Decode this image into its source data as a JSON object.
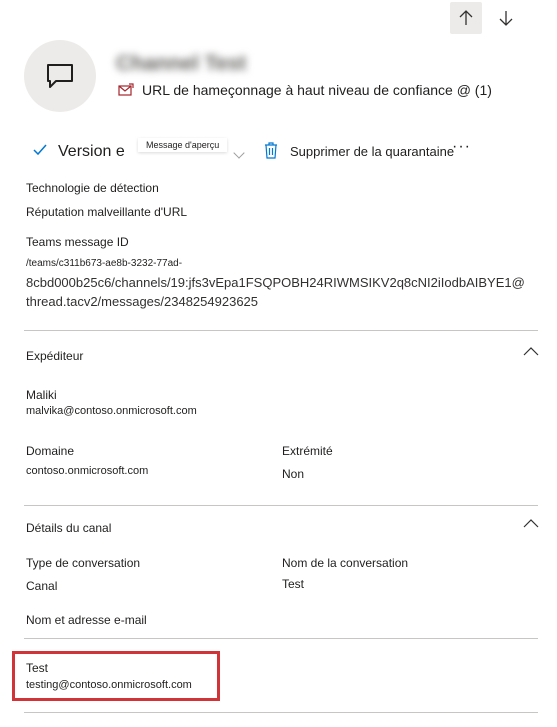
{
  "nav": {
    "up_icon": "arrow-up-icon",
    "down_icon": "arrow-down-icon"
  },
  "header": {
    "avatar_icon": "chat-message-icon",
    "title": "Channel Test",
    "threat_icon": "phish-mail-icon",
    "threat_label": "URL de hameçonnage à haut niveau de confiance @ (1)"
  },
  "toolbar": {
    "version_label": "Version e",
    "tooltip": "Message d'aperçu",
    "remove_label": "Supprimer de la quarantaine",
    "more_label": "···"
  },
  "details": {
    "tech_label": "Technologie de détection",
    "tech_value": "Réputation malveillante d'URL",
    "teams_id_label": "Teams message ID",
    "teams_id_line1": "/teams/c311b673-ae8b-3232-77ad-",
    "teams_id_line2": "8cbd000b25c6/channels/19:jfs3vEpa1FSQPOBH24RIWMSIKV2q8cNI2iIodbAIBYE1@",
    "teams_id_line3": "thread.tacv2/messages/2348254923625"
  },
  "sender": {
    "section_title": "Expéditeur",
    "name": "Maliki",
    "email": "malvika@contoso.onmicrosoft.com",
    "domain_label": "Domaine",
    "domain_value": "contoso.onmicrosoft.com",
    "endpoint_label": "Extrémité",
    "endpoint_value": "Non"
  },
  "channel": {
    "section_title": "Détails du canal",
    "conv_type_label": "Type de conversation",
    "conv_type_value": "Canal",
    "conv_name_label": "Nom de la conversation",
    "conv_name_value": "Test",
    "name_email_label": "Nom et adresse e-mail",
    "name_value": "Test",
    "email_value": "testing@contoso.onmicrosoft.com"
  },
  "colors": {
    "accent": "#0078d4",
    "highlight": "#d13438",
    "threat": "#a4262c"
  }
}
